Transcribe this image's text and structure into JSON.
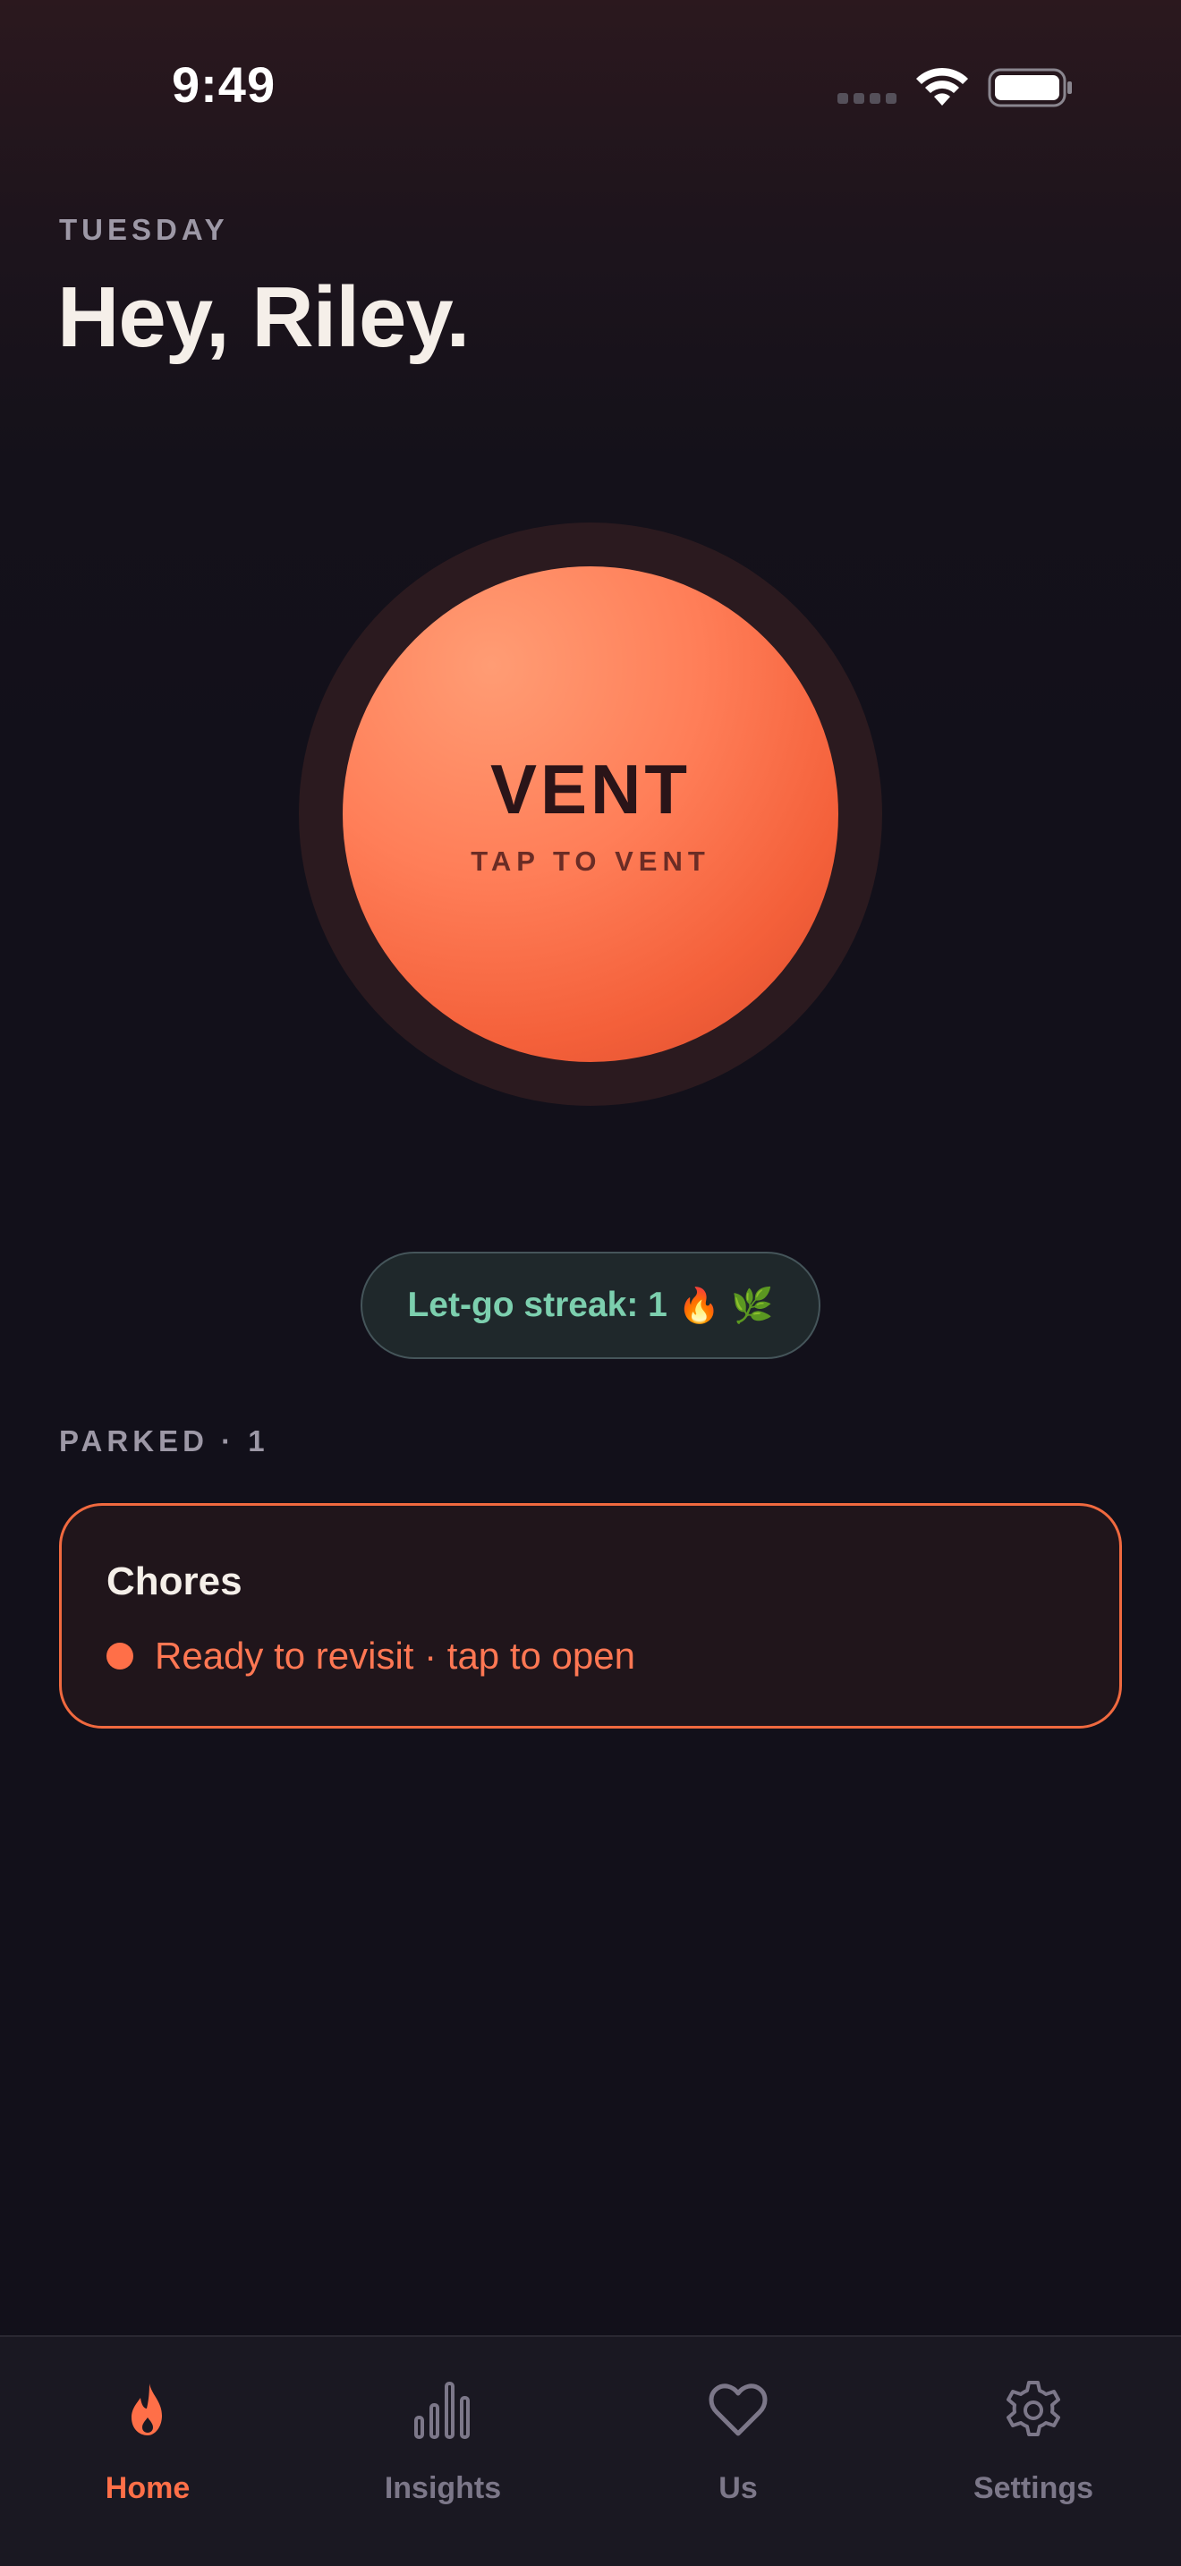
{
  "status_bar": {
    "time": "9:49"
  },
  "header": {
    "day": "TUESDAY",
    "greeting": "Hey, Riley."
  },
  "vent_button": {
    "label": "VENT",
    "sublabel": "TAP TO VENT"
  },
  "streak": {
    "text": "Let-go streak: 1",
    "emoji_fire": "🔥",
    "emoji_leaf": "🌿"
  },
  "parked": {
    "section_label": "PARKED · 1",
    "items": [
      {
        "title": "Chores",
        "status": "Ready to revisit · tap to open"
      }
    ]
  },
  "tab_bar": {
    "tabs": [
      {
        "label": "Home",
        "icon": "flame-icon",
        "active": true
      },
      {
        "label": "Insights",
        "icon": "bar-chart-icon",
        "active": false
      },
      {
        "label": "Us",
        "icon": "heart-icon",
        "active": false
      },
      {
        "label": "Settings",
        "icon": "gear-icon",
        "active": false
      }
    ]
  },
  "colors": {
    "accent": "#ff6f48",
    "background": "#12101a",
    "streak_text": "#7ccfae",
    "inactive_tab": "#7c7789"
  }
}
